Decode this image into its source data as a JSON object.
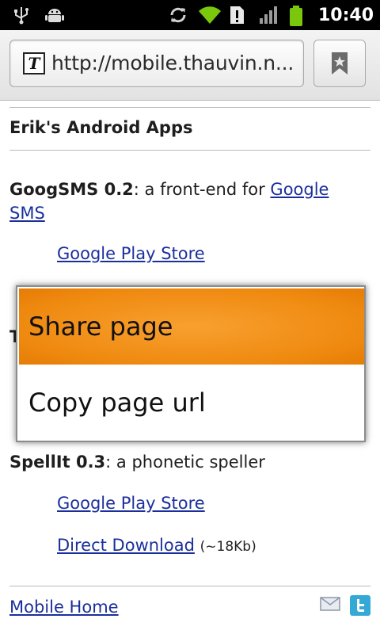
{
  "status_bar": {
    "time": "10:40",
    "icons": [
      "usb-icon",
      "android-debug-icon",
      "sync-icon",
      "wifi-icon",
      "alert-icon",
      "signal-icon",
      "battery-icon"
    ]
  },
  "url_bar": {
    "url": "http://mobile.thauvin.n...",
    "favicon_letter": "T"
  },
  "page": {
    "heading": "Erik's Android Apps",
    "app1": {
      "name": "GoogSMS 0.2",
      "desc": ": a front-end for ",
      "link": "Google",
      "link2": "SMS",
      "store_link": "Google Play Store"
    },
    "partial_letter": "T",
    "app3": {
      "name": "SpellIt 0.3",
      "desc": ": a phonetic speller",
      "store_link": "Google Play Store",
      "download_link": "Direct Download",
      "size": "(~18Kb)"
    },
    "footer_link": "Mobile Home"
  },
  "menu": {
    "items": [
      {
        "label": "Share page",
        "selected": true
      },
      {
        "label": "Copy page url",
        "selected": false
      }
    ]
  },
  "colors": {
    "link": "#1b2f9c",
    "highlight": "#ef8a10",
    "battery": "#7ac70c",
    "wifi": "#7ac70c"
  }
}
